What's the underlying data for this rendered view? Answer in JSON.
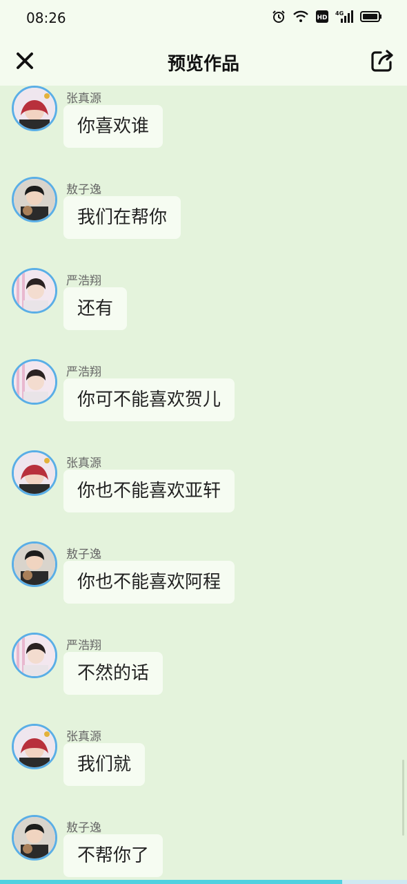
{
  "status_bar": {
    "time": "08:26",
    "icons": [
      "alarm-icon",
      "wifi-icon",
      "hd-icon",
      "signal-4g-icon",
      "battery-icon"
    ],
    "hd_label": "HD",
    "network_label": "4G"
  },
  "header": {
    "title": "预览作品",
    "close_icon": "close-icon",
    "share_icon": "share-icon"
  },
  "messages": [
    {
      "name": "张真源",
      "text": "你喜欢谁",
      "avatar": "zhang"
    },
    {
      "name": "敖子逸",
      "text": "我们在帮你",
      "avatar": "ao"
    },
    {
      "name": "严浩翔",
      "text": "还有",
      "avatar": "yan"
    },
    {
      "name": "严浩翔",
      "text": "你可不能喜欢贺儿",
      "avatar": "yan"
    },
    {
      "name": "张真源",
      "text": "你也不能喜欢亚轩",
      "avatar": "zhang"
    },
    {
      "name": "敖子逸",
      "text": "你也不能喜欢阿程",
      "avatar": "ao"
    },
    {
      "name": "严浩翔",
      "text": "不然的话",
      "avatar": "yan"
    },
    {
      "name": "张真源",
      "text": "我们就",
      "avatar": "zhang"
    },
    {
      "name": "敖子逸",
      "text": "不帮你了",
      "avatar": "ao"
    }
  ],
  "progress": {
    "fraction": 0.84
  },
  "colors": {
    "background": "#e4f3dc",
    "header": "#f4fbef",
    "bubble": "#f6fcf2",
    "avatar_border": "#5aaee6",
    "progress": "#4fd1e0"
  }
}
